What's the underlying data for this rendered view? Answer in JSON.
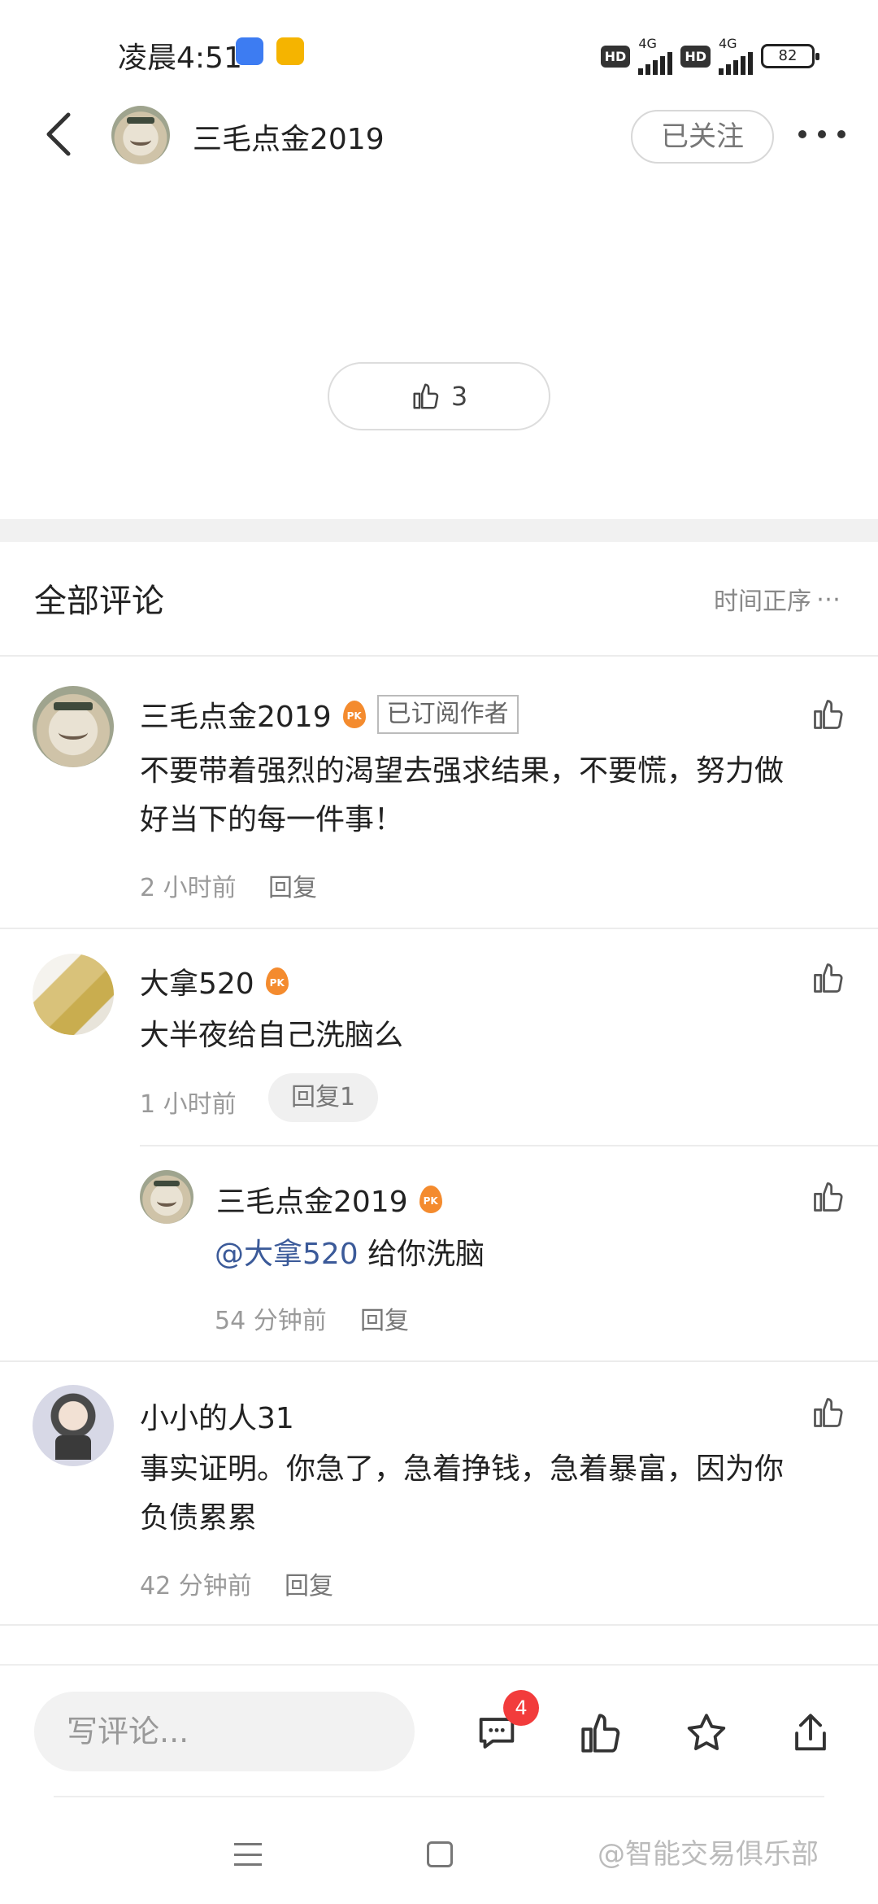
{
  "status_bar": {
    "time": "凌晨4:51",
    "hd1": "HD",
    "net1": "4G",
    "hd2": "HD",
    "net2": "4G",
    "battery": "82"
  },
  "header": {
    "author_name": "三毛点金2019",
    "follow_label": "已关注"
  },
  "post": {
    "like_count": "3"
  },
  "comments_section": {
    "title": "全部评论",
    "sort_label": "时间正序",
    "comments": [
      {
        "name": "三毛点金2019",
        "badge": "PK",
        "tag": "已订阅作者",
        "text_line1": "不要带着强烈的渴望去强求结果，不要慌，努力做",
        "text_line2": "好当下的每一件事！",
        "time": "2 小时前",
        "reply": "回复"
      },
      {
        "name": "大拿520",
        "badge": "PK",
        "text": "大半夜给自己洗脑么",
        "time": "1 小时前",
        "reply": "回复1",
        "replies": [
          {
            "name": "三毛点金2019",
            "badge": "PK",
            "mention": "@大拿520",
            "text": " 给你洗脑",
            "time": "54 分钟前",
            "reply": "回复"
          }
        ]
      },
      {
        "name": "小小的人31",
        "text_line1": "事实证明。你急了，急着挣钱，急着暴富，因为你",
        "text_line2": "负债累累",
        "time": "42 分钟前",
        "reply": "回复"
      }
    ]
  },
  "bottom_bar": {
    "input_placeholder": "写评论...",
    "comment_count_badge": "4"
  },
  "watermark": "@智能交易俱乐部",
  "colors": {
    "mention": "#3b5a99",
    "badge_red": "#f23c3c",
    "pk_orange": "#f48b2e"
  }
}
